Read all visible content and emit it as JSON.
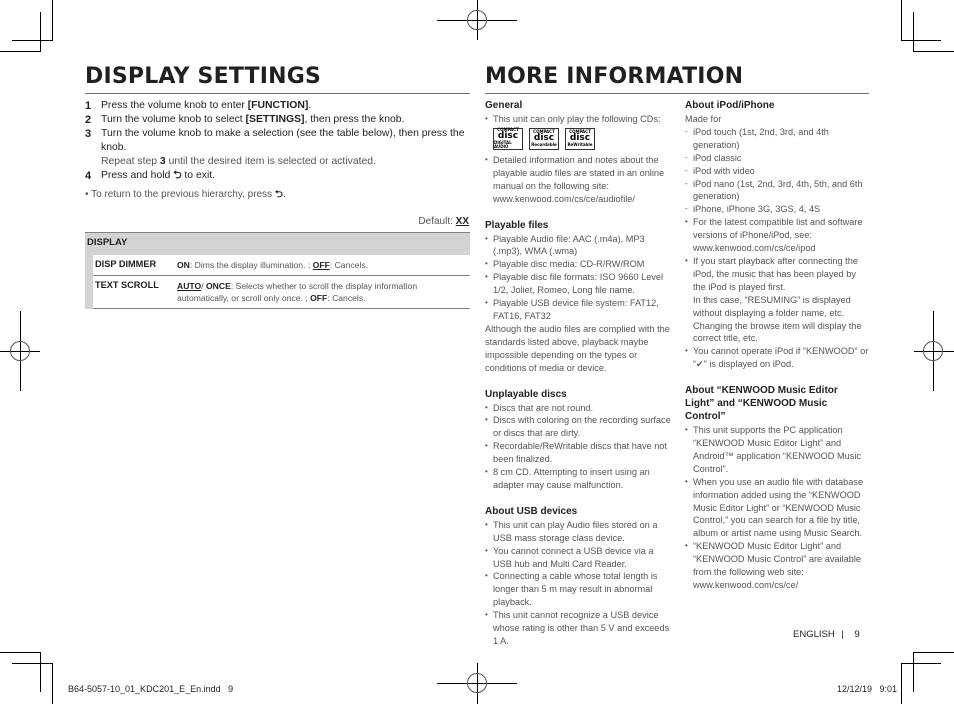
{
  "left": {
    "title": "DISPLAY SETTINGS",
    "steps": [
      {
        "num": "1",
        "pre": "Press the volume knob to enter ",
        "bold": "[FUNCTION]",
        "post": "."
      },
      {
        "num": "2",
        "pre": "Turn the volume knob to select ",
        "bold": "[SETTINGS]",
        "post": ", then press the knob."
      },
      {
        "num": "3",
        "text": "Turn the volume knob to make a selection (see the table below), then press the knob."
      },
      {
        "num": "4",
        "pre": "Press and hold ",
        "icon": "return-icon",
        "post": " to exit."
      }
    ],
    "repeat_pre": "Repeat step ",
    "repeat_step": "3",
    "repeat_post": " until the desired item is selected or activated.",
    "note_pre": "To return to the previous hierarchy, press ",
    "note_post": ".",
    "default_label": "Default: ",
    "default_value": "XX",
    "table": {
      "header": "DISPLAY",
      "rows": [
        {
          "key": "DISP DIMMER",
          "opt1": "ON",
          "desc1": ": Dims the display illumination. ; ",
          "opt2": "OFF",
          "desc2": ":  Cancels."
        },
        {
          "key": "TEXT SCROLL",
          "opt1": "AUTO",
          "sep": "/ ",
          "opt1b": "ONCE",
          "desc1": ": Selects whether to scroll the display information automatically, or scroll only once. ; ",
          "opt2": "OFF",
          "desc2": ": Cancels."
        }
      ]
    }
  },
  "right": {
    "title": "MORE INFORMATION",
    "general": {
      "heading": "General",
      "items": [
        "This unit can only play the following CDs:",
        "Detailed information and notes about the playable audio files are stated in an online manual on the following site: www.kenwood.com/cs/ce/audiofile/"
      ],
      "disc_logos": [
        {
          "top": "COMPACT",
          "main": "disc",
          "bottom": "DIGITAL AUDIO"
        },
        {
          "top": "COMPACT",
          "main": "disc",
          "bottom": "Recordable"
        },
        {
          "top": "COMPACT",
          "main": "disc",
          "bottom": "ReWritable"
        }
      ]
    },
    "playable": {
      "heading": "Playable files",
      "items": [
        "Playable Audio file: AAC (.m4a), MP3 (.mp3), WMA (.wma)",
        "Playable disc media: CD-R/RW/ROM",
        "Playable disc file formats: ISO 9660 Level 1/2, Joliet, Romeo, Long file name.",
        "Playable USB device file system: FAT12, FAT16, FAT32"
      ],
      "para": "Although the audio files are complied with the standards listed above, playback maybe impossible depending on the types or conditions of media or device."
    },
    "unplayable": {
      "heading": "Unplayable discs",
      "items": [
        "Discs that are not round.",
        "Discs with coloring on the recording surface or discs that are dirty.",
        "Recordable/ReWritable discs that have not been finalized.",
        "8 cm CD. Attempting to insert using an adapter may cause malfunction."
      ]
    },
    "usb": {
      "heading": "About USB devices",
      "items": [
        "This unit can play Audio files stored on a USB mass storage class device.",
        "You cannot connect a USB device via a USB hub and Multi Card Reader.",
        "Connecting a cable whose total length is longer than 5 m may result in abnormal playback.",
        "This unit cannot recognize a USB device whose rating is other than 5 V and exceeds 1 A."
      ]
    },
    "ipod": {
      "heading": "About iPod/iPhone",
      "made_for": "Made for",
      "models": [
        "iPod touch (1st, 2nd, 3rd, and 4th generation)",
        "iPod classic",
        "iPod with video",
        "iPod nano (1st, 2nd, 3rd, 4th, 5th, and 6th generation)",
        "iPhone, iPhone 3G, 3GS, 4, 4S"
      ],
      "items": [
        "For the latest compatible list and software versions of iPhone/iPod, see: www.kenwood.com/cs/ce/ipod",
        "If you start playback after connecting the iPod, the music that has been played by the iPod is played first.",
        "You cannot operate iPod if “KENWOOD” or “✔” is displayed on iPod."
      ],
      "resuming_note": "In this case, “RESUMING” is displayed without displaying a folder name, etc. Changing the browse item will display the correct title, etc."
    },
    "kenwood_apps": {
      "heading": "About “KENWOOD Music Editor Light” and “KENWOOD Music Control”",
      "items": [
        "This unit supports the PC application “KENWOOD Music Editor Light” and Android™ application “KENWOOD Music Control”.",
        "When you use an audio file with database information added using the “KENWOOD Music Editor Light” or “KENWOOD Music Control,” you can search for a file by title, album or artist name using Music Search.",
        "“KENWOOD Music Editor Light” and “KENWOOD Music Control” are available from the following web site: www.kenwood.com/cs/ce/"
      ]
    }
  },
  "footer": {
    "language": "ENGLISH",
    "separator": "|",
    "page": "9",
    "file": "B64-5057-10_01_KDC201_E_En.indd   9",
    "datetime": "12/12/19   9:01"
  }
}
